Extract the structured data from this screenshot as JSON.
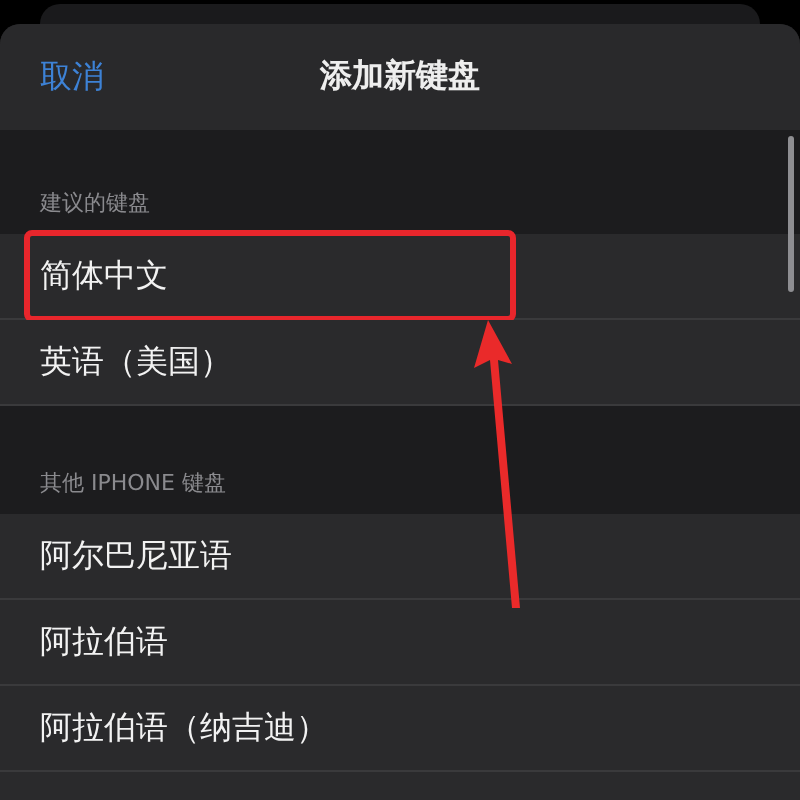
{
  "nav_bar": {
    "cancel": "取消",
    "title": "添加新键盘"
  },
  "sections": [
    {
      "header": "建议的键盘",
      "items": [
        {
          "label": "简体中文",
          "highlighted": true
        },
        {
          "label": "英语（美国）",
          "highlighted": false
        }
      ]
    },
    {
      "header": "其他 IPHONE 键盘",
      "items": [
        {
          "label": "阿尔巴尼亚语",
          "highlighted": false
        },
        {
          "label": "阿拉伯语",
          "highlighted": false
        },
        {
          "label": "阿拉伯语（纳吉迪）",
          "highlighted": false
        }
      ]
    }
  ]
}
